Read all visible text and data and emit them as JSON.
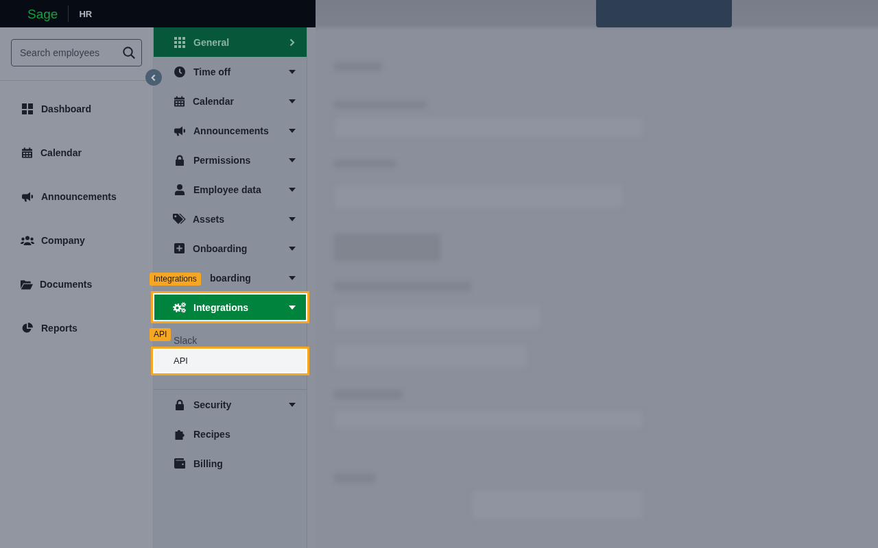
{
  "header": {
    "logo": "Sage",
    "product": "HR"
  },
  "search": {
    "placeholder": "Search employees"
  },
  "sidebar": {
    "items": [
      {
        "label": "Dashboard"
      },
      {
        "label": "Calendar"
      },
      {
        "label": "Announcements"
      },
      {
        "label": "Company"
      },
      {
        "label": "Documents"
      },
      {
        "label": "Reports"
      }
    ]
  },
  "settings_menu": {
    "items": [
      {
        "label": "General",
        "kind": "item",
        "has_submenu": false,
        "selected": true,
        "expanded": false,
        "highlighted": false
      },
      {
        "label": "Time off",
        "kind": "item",
        "has_submenu": true,
        "selected": false,
        "expanded": false,
        "highlighted": false
      },
      {
        "label": "Calendar",
        "kind": "item",
        "has_submenu": true,
        "selected": false,
        "expanded": false,
        "highlighted": false
      },
      {
        "label": "Announcements",
        "kind": "item",
        "has_submenu": true,
        "selected": false,
        "expanded": false,
        "highlighted": false
      },
      {
        "label": "Permissions",
        "kind": "item",
        "has_submenu": true,
        "selected": false,
        "expanded": false,
        "highlighted": false
      },
      {
        "label": "Employee data",
        "kind": "item",
        "has_submenu": true,
        "selected": false,
        "expanded": false,
        "highlighted": false
      },
      {
        "label": "Assets",
        "kind": "item",
        "has_submenu": true,
        "selected": false,
        "expanded": false,
        "highlighted": false
      },
      {
        "label": "Onboarding",
        "kind": "item",
        "has_submenu": true,
        "selected": false,
        "expanded": false,
        "highlighted": false
      },
      {
        "label": "boarding",
        "kind": "covered",
        "has_submenu": true,
        "selected": false,
        "expanded": false,
        "highlighted": false
      },
      {
        "label": "Integrations",
        "kind": "item",
        "has_submenu": true,
        "selected": true,
        "expanded": true,
        "highlighted": true,
        "tag": "Integrations",
        "children": [
          {
            "label": "Slack",
            "highlighted": false
          },
          {
            "label": "API",
            "highlighted": true,
            "tag": "API"
          }
        ]
      },
      {
        "label": "Security",
        "kind": "item",
        "has_submenu": true,
        "selected": false,
        "expanded": false,
        "highlighted": false
      },
      {
        "label": "Recipes",
        "kind": "item",
        "has_submenu": false,
        "selected": false,
        "expanded": false,
        "highlighted": false
      },
      {
        "label": "Billing",
        "kind": "item",
        "has_submenu": false,
        "selected": false,
        "expanded": false,
        "highlighted": false
      }
    ]
  }
}
